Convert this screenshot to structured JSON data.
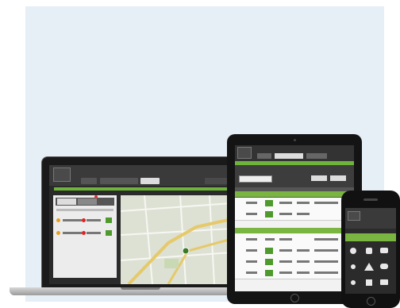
{
  "scene": {
    "background_color": "#e6eef6",
    "accent_color": "#6fb43a",
    "devices": [
      "laptop",
      "tablet",
      "phone"
    ]
  },
  "laptop": {
    "tabs": 3,
    "list_rows": [
      {
        "status_color": "#e8a020"
      },
      {
        "status_color": "#e8a020"
      }
    ]
  },
  "tablet": {
    "section_count": 2,
    "rows": 6
  },
  "phone": {
    "icon_grid": [
      "map-pin-icon",
      "gear-icon",
      "car-icon",
      "person-icon",
      "alert-icon",
      "chat-icon",
      "user-icon",
      "route-icon",
      "camera-icon",
      "bell-icon"
    ]
  }
}
